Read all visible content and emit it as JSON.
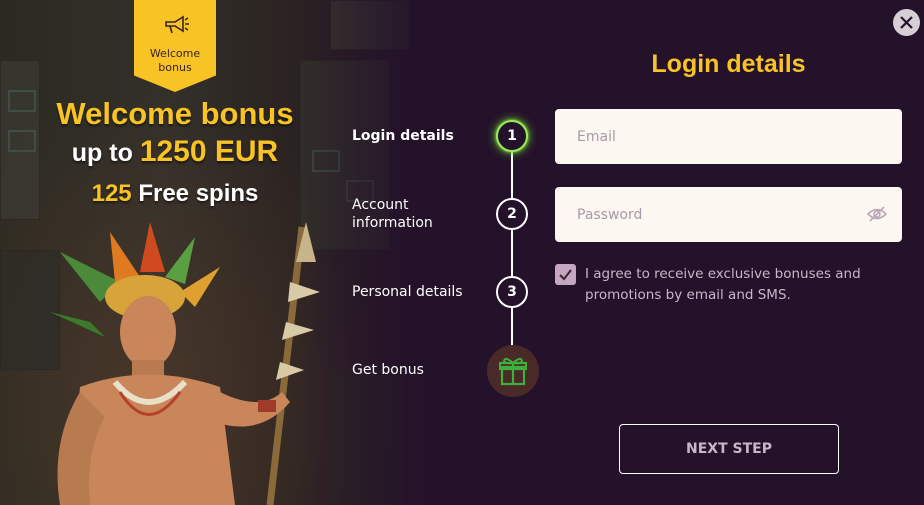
{
  "promo": {
    "ribbon_label": "Welcome\nbonus",
    "title": "Welcome bonus",
    "amount_prefix": "up to",
    "amount_value": "1250 EUR",
    "spins_count": "125",
    "spins_text": "Free spins"
  },
  "stepper": {
    "steps": [
      {
        "label": "Login details",
        "number": "1",
        "state": "active"
      },
      {
        "label": "Account information",
        "number": "2",
        "state": "pending"
      },
      {
        "label": "Personal details",
        "number": "3",
        "state": "pending"
      },
      {
        "label": "Get bonus",
        "icon": "gift-icon",
        "state": "pending"
      }
    ]
  },
  "form": {
    "title": "Login details",
    "email_placeholder": "Email",
    "email_value": "",
    "password_placeholder": "Password",
    "password_value": "",
    "consent_checked": true,
    "consent_text": "I agree to receive exclusive bonuses and promotions by email and SMS.",
    "next_label": "NEXT STEP"
  },
  "icons": {
    "close": "close-icon",
    "password_toggle": "eye-off-icon",
    "ribbon": "megaphone-icon",
    "gift": "gift-icon"
  },
  "colors": {
    "background": "#24112a",
    "accent": "#f8c324",
    "active_step": "#9bea57",
    "input_bg": "#fdf7f1",
    "checkbox": "#c5a7c4",
    "muted_text": "#c7b7c8"
  }
}
